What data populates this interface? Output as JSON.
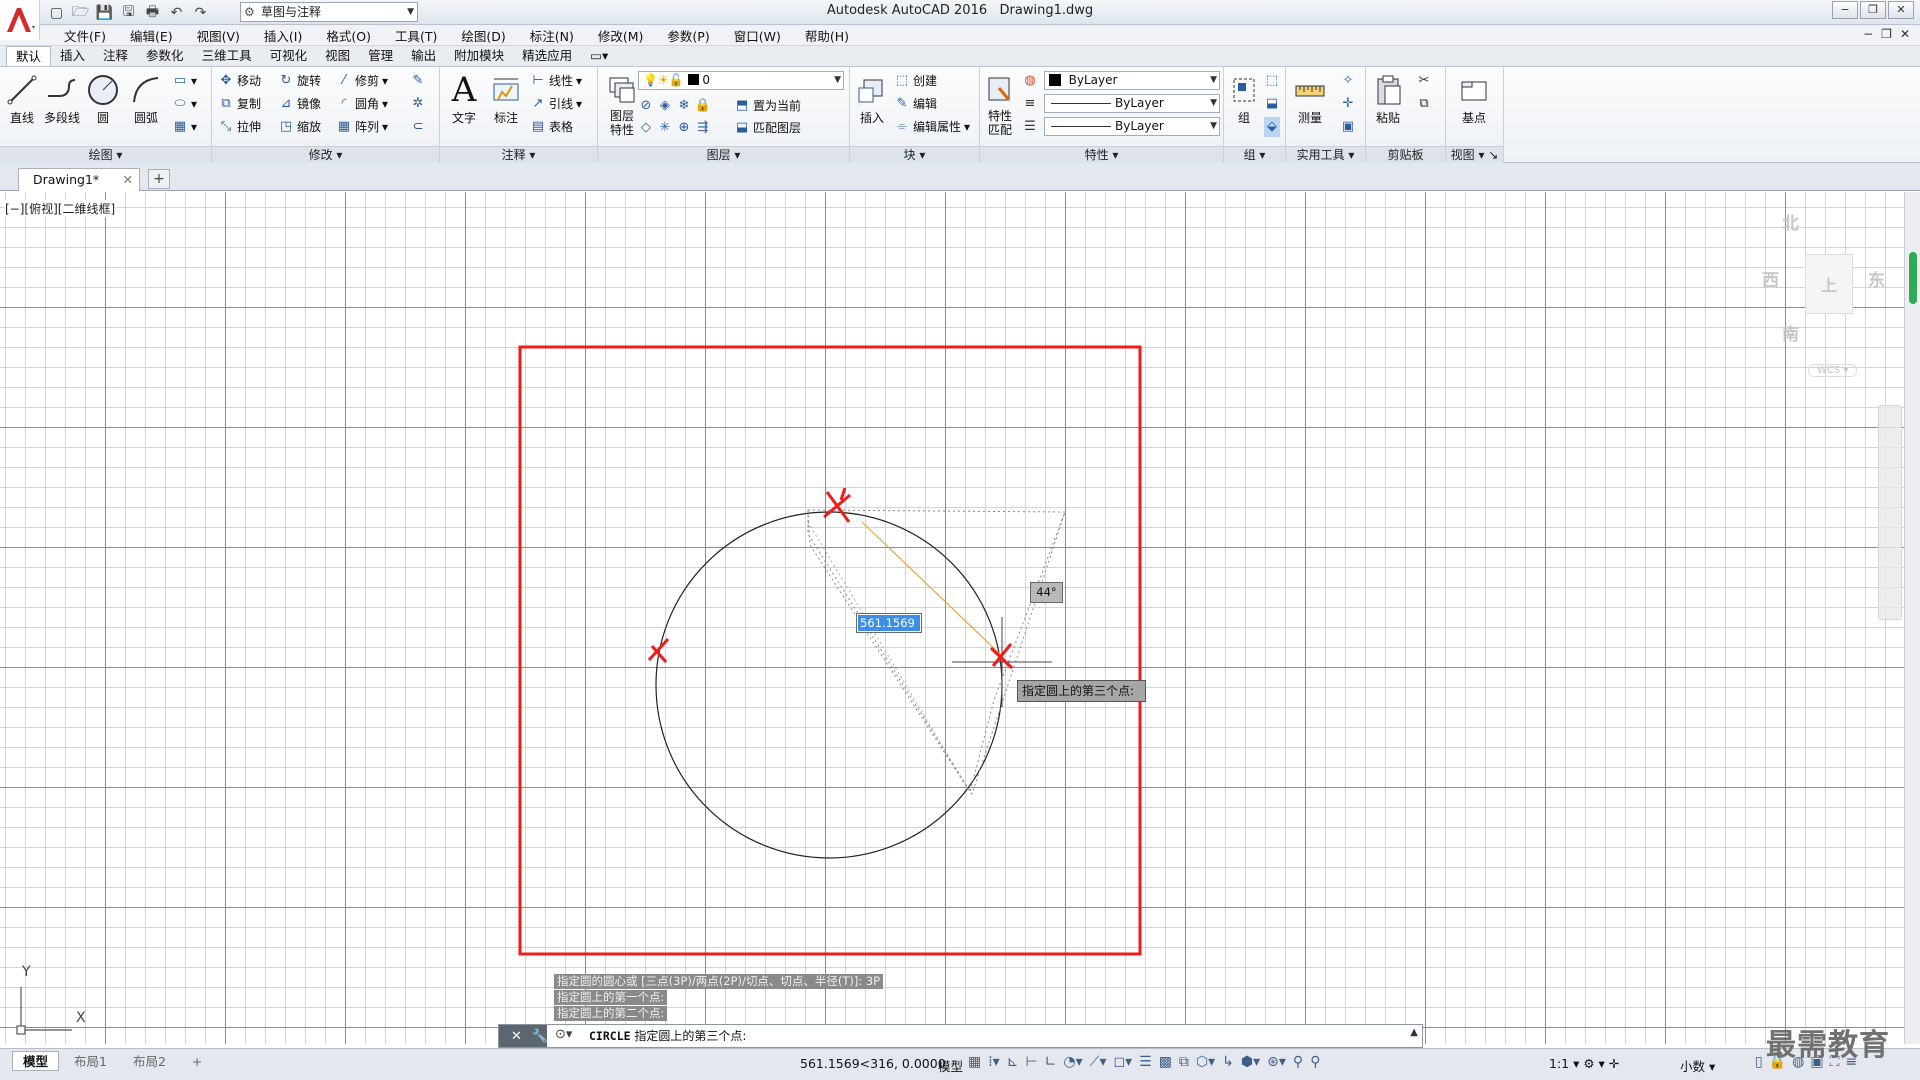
{
  "title": {
    "app": "Autodesk AutoCAD 2016",
    "file": "Drawing1.dwg",
    "workspace": "草图与注释",
    "window_controls": [
      "−",
      "❐",
      "✕"
    ]
  },
  "menubar": {
    "items": [
      "文件(F)",
      "编辑(E)",
      "视图(V)",
      "插入(I)",
      "格式(O)",
      "工具(T)",
      "绘图(D)",
      "标注(N)",
      "修改(M)",
      "参数(P)",
      "窗口(W)",
      "帮助(H)"
    ],
    "doc_controls": [
      "−",
      "❐",
      "✕"
    ]
  },
  "ribbon": {
    "tabs": [
      "默认",
      "插入",
      "注释",
      "参数化",
      "三维工具",
      "可视化",
      "视图",
      "管理",
      "输出",
      "附加模块",
      "精选应用",
      "▭▾"
    ],
    "active_tab": "默认",
    "draw": {
      "title": "绘图",
      "line": "直线",
      "polyline": "多段线",
      "circle": "圆",
      "arc": "圆弧"
    },
    "modify": {
      "title": "修改",
      "move": "移动",
      "rotate": "旋转",
      "trim": "修剪",
      "copy": "复制",
      "mirror": "镜像",
      "fillet": "圆角",
      "stretch": "拉伸",
      "scale": "缩放",
      "array": "阵列"
    },
    "annotation": {
      "title": "注释",
      "text": "文字",
      "dimension": "标注",
      "linear": "线性",
      "leader": "引线",
      "table": "表格"
    },
    "layers": {
      "title": "图层",
      "properties": "图层\n特性",
      "current_layer": "0",
      "make_current": "置为当前",
      "match_layer": "匹配图层"
    },
    "block": {
      "title": "块",
      "insert": "插入",
      "create": "创建",
      "edit": "编辑",
      "edit_attr": "编辑属性"
    },
    "properties": {
      "title": "特性",
      "match": "特性\n匹配",
      "color": "ByLayer",
      "linetype": "ByLayer",
      "lineweight": "ByLayer"
    },
    "groups": {
      "title": "组",
      "group": "组"
    },
    "utilities": {
      "title": "实用工具",
      "measure": "测量"
    },
    "clipboard": {
      "title": "剪贴板",
      "paste": "粘贴"
    },
    "view": {
      "title": "视图",
      "base": "基点"
    }
  },
  "doc_tab": {
    "name": "Drawing1*",
    "close": "✕",
    "add": "+"
  },
  "viewport": {
    "label": "[−][俯视][二维线框]"
  },
  "viewcube": {
    "north": "北",
    "south": "南",
    "east": "东",
    "west": "西",
    "top": "上",
    "wcs": "WCS"
  },
  "drawing": {
    "dim_value": "561.1569",
    "angle": "44°",
    "cursor_prompt": "指定圆上的第三个点:",
    "accent": "#ee1c1c"
  },
  "command": {
    "history": [
      "指定圆的圆心或 [三点(3P)/两点(2P)/切点、切点、半径(T)]: 3P",
      "指定圆上的第一个点:",
      "指定圆上的第二个点:"
    ],
    "current_cmd": "CIRCLE",
    "current_prompt": "指定圆上的第三个点:"
  },
  "ucs": {
    "x": "X",
    "y": "Y"
  },
  "statusbar": {
    "tabs": [
      "模型",
      "布局1",
      "布局2"
    ],
    "add": "+",
    "coords": "561.1569<316, 0.0000",
    "model": "模型",
    "scale": "1:1",
    "units": "小数"
  },
  "watermark": "最需教育"
}
